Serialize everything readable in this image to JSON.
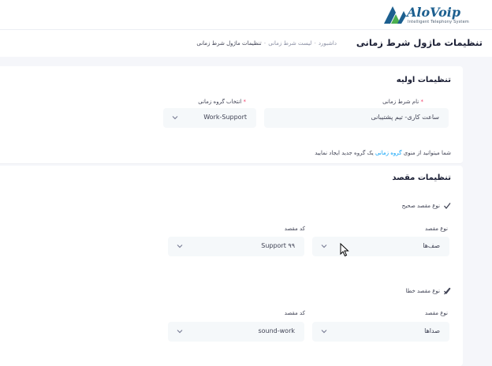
{
  "brand": {
    "name": "AloVoip",
    "tagline": "Intelligent Telephony System"
  },
  "header": {
    "page_title": "تنظیمات ماژول شرط زمانی",
    "breadcrumb": [
      "داشبورد",
      "لیست شرط زمانی",
      "تنظیمات ماژول شرط زمانی"
    ]
  },
  "basic_settings": {
    "title": "تنظیمات اولیه",
    "name_label": "نام شرط زمانی",
    "name_value": "ساعت کاری- تیم پشتیبانی",
    "group_label": "انتخاب گروه زمانی",
    "group_value": "Work-Support",
    "hint_before": "شما میتوانید از منوی",
    "hint_link": "گروه زمانی",
    "hint_after": "یک گروه جدید ایجاد نمایید"
  },
  "destination_settings": {
    "title": "تنظیمات مقصد",
    "correct": {
      "check_label": "نوع مقصد صحیح",
      "type_label": "نوع مقصد",
      "type_value": "صف‌ها",
      "code_label": "کد مقصد",
      "code_value": "Support ۹۹"
    },
    "error": {
      "check_label": "نوع مقصد خطا",
      "type_label": "نوع مقصد",
      "type_value": "صداها",
      "code_label": "کد مقصد",
      "code_value": "sound-work"
    }
  },
  "colors": {
    "accent": "#009ef7",
    "required": "#f1416c",
    "field_bg": "#f5f8fa",
    "logo_green": "#4caf50",
    "logo_blue": "#1c5f8f"
  }
}
